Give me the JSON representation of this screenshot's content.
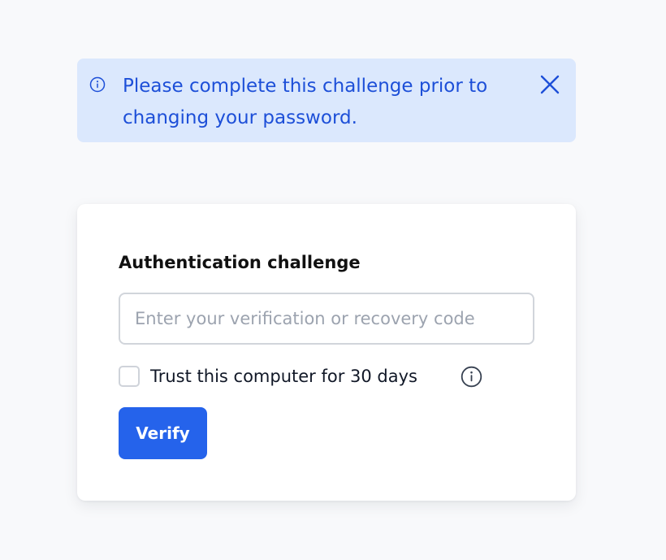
{
  "alert": {
    "message": "Please complete this challenge prior to changing your password.",
    "icon": "info-icon",
    "close_icon": "close-icon",
    "text_color": "#1d4fd8",
    "background": "#dbe8fd"
  },
  "challenge": {
    "title": "Authentication challenge",
    "code_input": {
      "value": "",
      "placeholder": "Enter your verification or recovery code"
    },
    "trust_checkbox": {
      "label": "Trust this computer for 30 days",
      "checked": false,
      "info_icon": "info-icon"
    },
    "verify_label": "Verify",
    "accent": "#2563eb"
  }
}
